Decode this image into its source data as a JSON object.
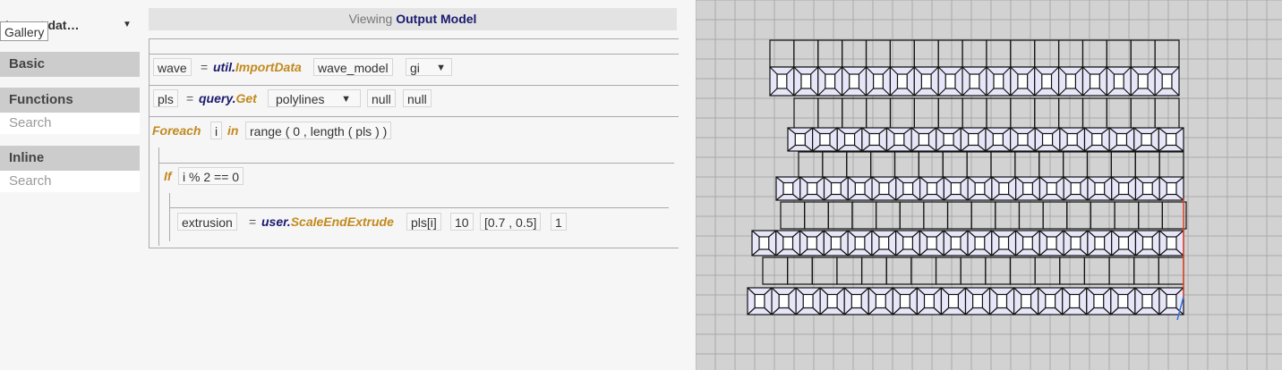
{
  "sidebar": {
    "dropdown_label": "Import dat…",
    "tooltip": "Gallery",
    "sections": [
      {
        "title": "Basic"
      },
      {
        "title": "Functions",
        "search_placeholder": "Search"
      },
      {
        "title": "Inline",
        "search_placeholder": "Search"
      }
    ]
  },
  "editor": {
    "viewing_prefix": "Viewing",
    "viewing_target": "Output Model",
    "lines": {
      "l1": {
        "var": "wave",
        "eq": "=",
        "mod": "util.",
        "fn": "ImportData",
        "args": [
          "wave_model",
          "gi"
        ]
      },
      "l2": {
        "var": "pls",
        "eq": "=",
        "mod": "query.",
        "fn": "Get",
        "args": [
          "polylines",
          "null",
          "null"
        ]
      },
      "l3": {
        "kw": "Foreach",
        "var": "i",
        "kw2": "in",
        "expr": "range ( 0 , length ( pls ) )"
      },
      "l4": {
        "kw": "If",
        "cond": "i % 2 == 0"
      },
      "l5": {
        "var": "extrusion",
        "eq": "=",
        "mod": "user.",
        "fn": "ScaleEndExtrude",
        "args": [
          "pls[i]",
          "10",
          "[0.7 , 0.5]",
          "1"
        ]
      }
    },
    "dropdown_arrow": "▼"
  },
  "viewport": {
    "background": "#d2d2d2",
    "grid_color": "#a9a9a9",
    "model_face_color": "#e6e6f8",
    "axis_colors": {
      "x": "#e0402a",
      "y": "#3a70e0"
    }
  }
}
